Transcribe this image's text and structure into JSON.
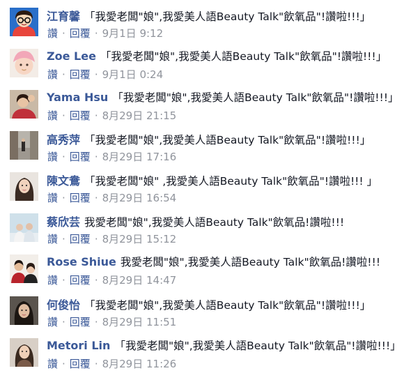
{
  "labels": {
    "like": "讚",
    "reply": "回覆",
    "separator": "·"
  },
  "comments": [
    {
      "author": "江育馨",
      "text": "「我愛老闆\"娘\",我愛美人語Beauty Talk\"飲氧品\"!讚啦!!!」",
      "time": "9月1日 9:12",
      "avatar": "cartoon-girl-glasses"
    },
    {
      "author": "Zoe Lee",
      "text": "「我愛老闆\"娘\",我愛美人語Beauty Talk\"飲氧品\"!讚啦!!!」",
      "time": "9月1日 0:24",
      "avatar": "baby-pink-hat"
    },
    {
      "author": "Yama Hsu",
      "text": "「我愛老闆\"娘\",我愛美人語Beauty Talk\"飲氧品\"!讚啦!!!」",
      "time": "8月29日 21:15",
      "avatar": "woman-red-top"
    },
    {
      "author": "高秀萍",
      "text": "「我愛老闆\"娘\",我愛美人語Beauty Talk\"飲氧品\"!讚啦!!!」",
      "time": "8月29日 17:16",
      "avatar": "street-scene"
    },
    {
      "author": "陳文鴦",
      "text": "「我愛老闆\"娘\" ,我愛美人語Beauty Talk\"飲氧品\"!讚啦!!! 」",
      "time": "8月29日 16:54",
      "avatar": "woman-long-hair"
    },
    {
      "author": "蔡欣芸",
      "text": "我愛老闆\"娘\",我愛美人語Beauty Talk\"飲氧品!讚啦!!!",
      "time": "8月29日 15:12",
      "avatar": "couple-light"
    },
    {
      "author": "Rose Shiue",
      "text": "我愛老闆\"娘\",我愛美人語Beauty Talk\"飲氧品!讚啦!!!",
      "time": "8月29日 14:47",
      "avatar": "couple-red"
    },
    {
      "author": "何俊怡",
      "text": "「我愛老闆\"娘\",我愛美人語Beauty Talk\"飲氧品\"!讚啦!!!」",
      "time": "8月29日 11:51",
      "avatar": "woman-dark"
    },
    {
      "author": "Metori Lin",
      "text": "「我愛老闆\"娘\",我愛美人語Beauty Talk\"飲氧品\"!讚啦!!!」",
      "time": "8月29日 11:26",
      "avatar": "woman-portrait"
    }
  ]
}
